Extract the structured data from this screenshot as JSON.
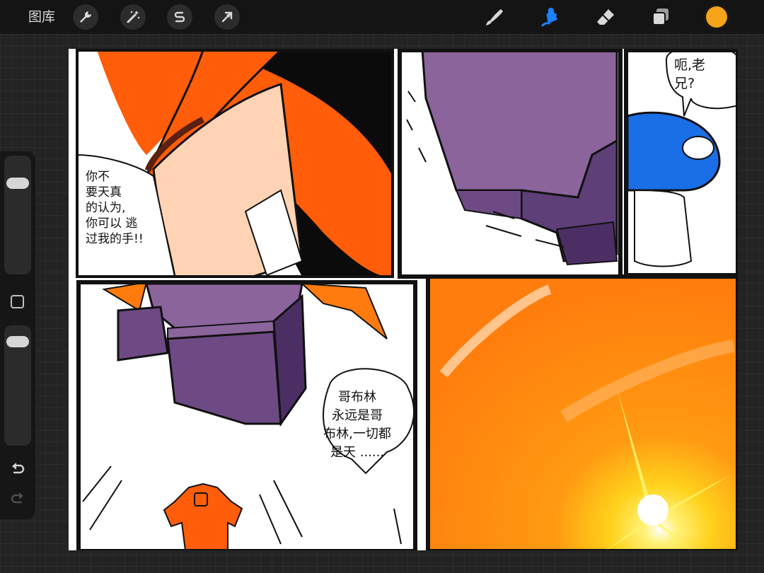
{
  "toolbar": {
    "gallery_label": "图库",
    "left_tools": [
      "wrench-icon",
      "magic-wand-icon",
      "selection-icon",
      "transform-arrow-icon"
    ],
    "right_tools": [
      "brush-icon",
      "smudge-icon",
      "eraser-icon",
      "layers-icon"
    ],
    "active_tool": "smudge-icon",
    "active_color": "#f5a41c",
    "accent": "#1a82ff"
  },
  "sidebar": {
    "brush_size_level": 0.18,
    "opacity_level": 0.06
  },
  "comic": {
    "panel1_text": "你不\n要天真\n的认为,\n你可以 逃\n过我的手!!",
    "panel3_text": "呃,老\n兄?",
    "panel5_text": "哥布林\n永远是哥\n布林,一切都\n是天 ......"
  }
}
